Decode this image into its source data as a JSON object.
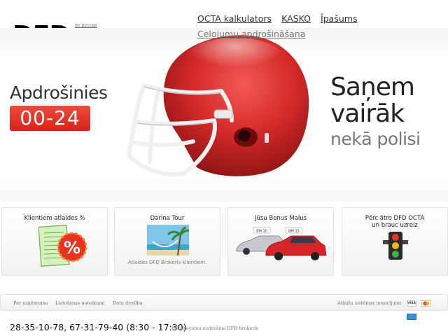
{
  "header": {
    "logo": "DFD",
    "lang_link": "по русски",
    "nav": [
      {
        "label": "OCTA kalkulators"
      },
      {
        "label": "KASKO"
      },
      {
        "label": "Īpašums"
      },
      {
        "label": "Ceļojumu apdrošināšana"
      }
    ]
  },
  "hero": {
    "left_title": "Apdrošinies",
    "hours": "00-24",
    "right_line1": "Saņem",
    "right_line2": "vairāk",
    "right_line3": "nekā polisi"
  },
  "boxes": [
    {
      "title": "Klientiem atlaides %",
      "subtitle": "",
      "icon": "discount-icon"
    },
    {
      "title": "Darina Tour",
      "subtitle": "Atlaides DFD Brokeris klientiem.",
      "icon": "beach-hammock-image"
    },
    {
      "title": "Jūsu Bonus Malus",
      "subtitle": "",
      "icon": "cars-image",
      "car_badge_1": "BM 10",
      "car_badge_2": "BM 15"
    },
    {
      "title_line1": "Pērc ātro DFD OCTA",
      "title_line2": "un brauc uzreiz",
      "subtitle": "",
      "icon": "traffic-light-icon"
    }
  ],
  "footer": {
    "links": [
      {
        "label": "Par uzņēmumu"
      },
      {
        "label": "Lietošanas noteikumi"
      },
      {
        "label": "Datu drošība"
      }
    ],
    "payment_terms": "Atlaižu sistēmas nosacījumi",
    "cards": [
      {
        "name": "visa-card-icon",
        "label": "VISA",
        "color": "#1a3a8c"
      },
      {
        "name": "mastercard-icon",
        "label": "",
        "color": "#e8a020"
      },
      {
        "name": "amex-card-icon",
        "label": "",
        "color": "#3a8fd0"
      }
    ],
    "phone": "28-35-10-78, 67-31-79-40 (8:30 - 17:30)",
    "copyright": "Pakalpojumu nodrošina DFD brokeris"
  },
  "colors": {
    "accent_red": "#d8231a",
    "helmet_red": "#d52a2a",
    "text_dark": "#222222",
    "text_muted": "#777777"
  }
}
